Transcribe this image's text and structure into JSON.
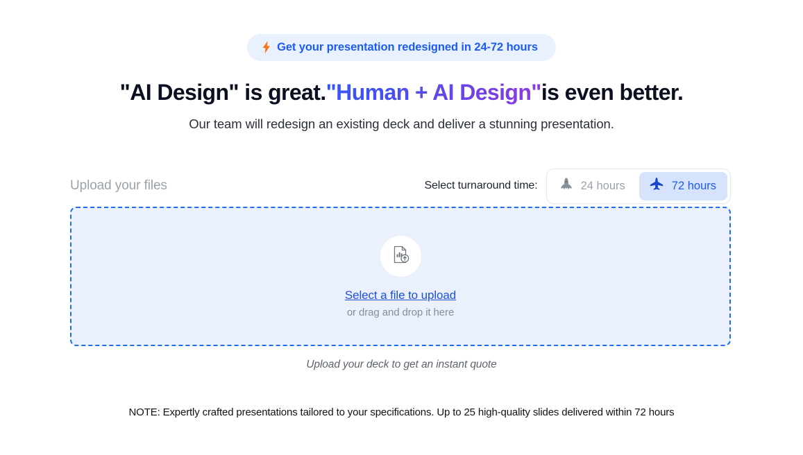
{
  "badge": {
    "icon": "lightning-bolt-icon",
    "text": "Get your presentation redesigned in 24-72 hours",
    "text_color": "#1d5cf0",
    "bg_color": "#e9f1fe",
    "icon_color": "#f97316"
  },
  "headline": {
    "part1": "\"AI Design\" is great.",
    "highlight": "\"Human + AI Design\"",
    "part2": "is even better.",
    "gradient_from": "#3358f4",
    "gradient_to": "#8a3ddf"
  },
  "subhead": "Our team will redesign an existing deck and deliver a stunning presentation.",
  "uploader": {
    "title": "Upload your files",
    "turnaround_label": "Select turnaround time:",
    "options": [
      {
        "icon": "space-shuttle-icon",
        "label": "24 hours",
        "selected": false
      },
      {
        "icon": "fighter-jet-icon",
        "label": "72 hours",
        "selected": true
      }
    ],
    "dropzone": {
      "icon": "document-chart-upload-icon",
      "link_text": "Select a file to upload",
      "hint_text": "or drag and drop it here",
      "border_color": "#1d6bf0",
      "bg_color": "#eaf1fd"
    }
  },
  "quote_note": "Upload your deck to get an instant quote",
  "footer_note": "NOTE: Expertly crafted presentations tailored to your specifications. Up to 25 high-quality slides delivered within 72 hours"
}
